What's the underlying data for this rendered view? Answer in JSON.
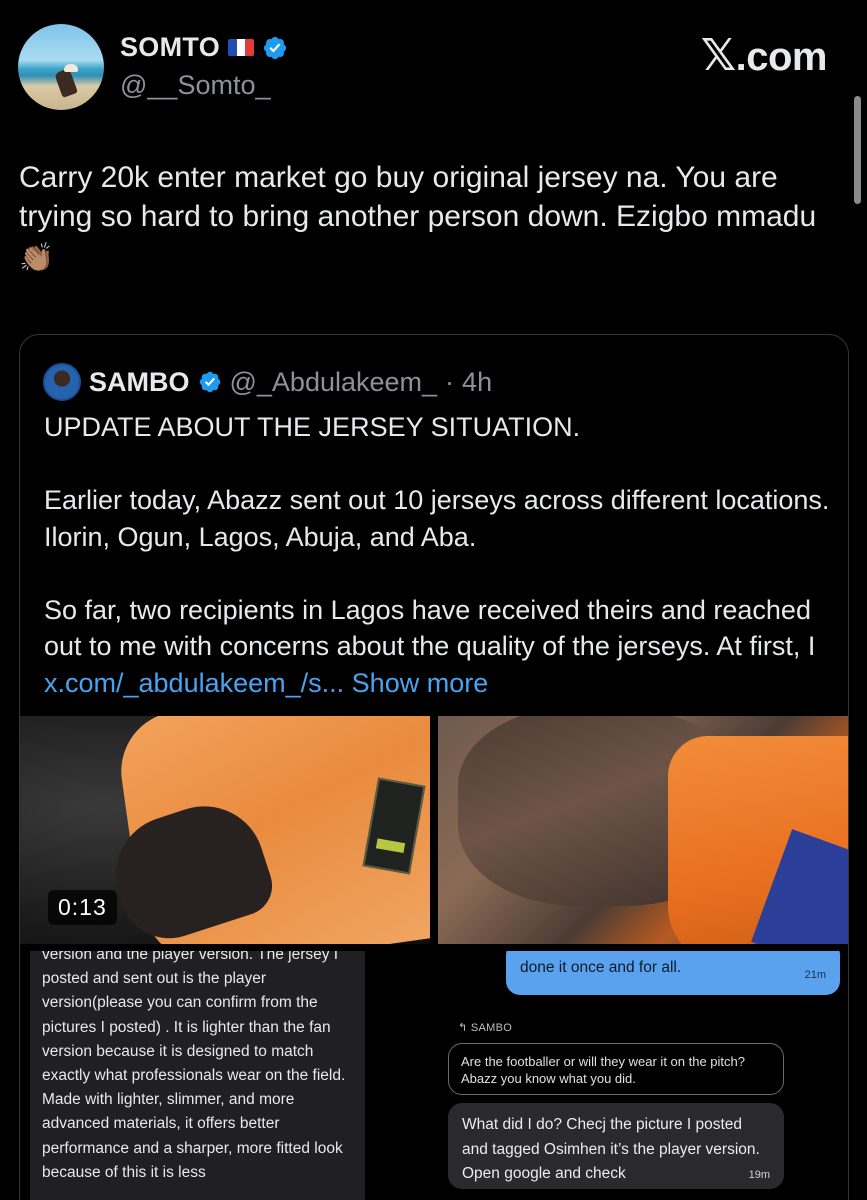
{
  "author": {
    "display_name": "SOMTO",
    "flag_icon": "france-flag-icon",
    "verified_icon": "verified-badge-icon",
    "handle": "@__Somto_"
  },
  "brand": {
    "logo_text": ".com",
    "logo_icon": "x-logo-icon"
  },
  "tweet": {
    "text": "Carry 20k enter market go buy original jersey na. You are trying so hard to bring another person down. Ezigbo mmadu",
    "emoji": "👏🏽"
  },
  "quote": {
    "display_name": "SAMBO",
    "handle": "@_Abdulakeem_",
    "separator": "·",
    "time": "4h",
    "paragraphs": [
      "UPDATE ABOUT THE JERSEY SITUATION.",
      "Earlier today, Abazz sent out 10 jerseys across different locations. Ilorin, Ogun, Lagos, Abuja, and Aba."
    ],
    "last_paragraph_text": "So far, two recipients in Lagos have received theirs and reached out to me with concerns about the quality of the jerseys. At first, I ",
    "link_text": "x.com/_abdulakeem_/s...",
    "show_more": "Show more",
    "media": {
      "video_duration": "0:13",
      "screenshot_left_text": "version and the player version. The jersey I posted and sent out is the player version(please you can confirm from the pictures I posted) . It is lighter than the fan version because it is designed to match exactly what professionals wear on the field. Made with lighter, slimmer, and more advanced materials, it offers better performance and a sharper, more fitted look because of this it is less",
      "chat": {
        "blue_bubble_text": "done it once and for all.",
        "blue_bubble_time": "21m",
        "reply_label": "↰ SAMBO",
        "replied_message": "Are the footballer or will they wear it on the pitch? Abazz you know what you did.",
        "reply_text": "What did I do? Checj the picture I posted and tagged Osimhen it’s the player version. Open google and check",
        "reply_time": "19m"
      }
    }
  },
  "colors": {
    "background": "#000000",
    "text": "#e7e9ea",
    "muted": "#8b9298",
    "link": "#4aa3f0",
    "verified": "#1d9bf0"
  }
}
